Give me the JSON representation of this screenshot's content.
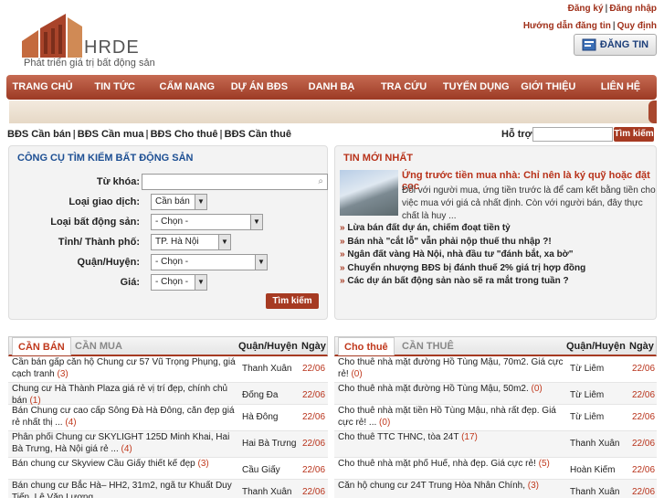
{
  "header": {
    "logo_brand": "HRDE",
    "logo_tagline": "Phát triển giá trị bất động sản",
    "register": "Đăng ký",
    "login": "Đăng nhập",
    "guide": "Hướng dẫn đăng tin",
    "rules": "Quy định",
    "post_button": "ĐĂNG TIN"
  },
  "nav": [
    "TRANG CHỦ",
    "TIN TỨC",
    "CẨM NANG",
    "DỰ ÁN BĐS",
    "DANH BẠ",
    "TRA CỨU",
    "TUYỂN DỤNG",
    "GIỚI THIỆU",
    "LIÊN HỆ"
  ],
  "categories": [
    "BĐS Cần bán",
    "BĐS Cần mua",
    "BĐS Cho thuê",
    "BĐS Cần thuê"
  ],
  "support": {
    "label": "Hỗ trợ",
    "search_button": "Tìm kiếm"
  },
  "search_tool": {
    "title": "CÔNG CỤ TÌM KIẾM BẤT ĐỘNG SẢN",
    "fields": [
      {
        "label": "Từ khóa:",
        "value": ""
      },
      {
        "label": "Loại giao dịch:",
        "value": "Cần bán"
      },
      {
        "label": "Loại bất động sản:",
        "value": "- Chọn -"
      },
      {
        "label": "Tỉnh/ Thành phố:",
        "value": "TP. Hà Nội"
      },
      {
        "label": "Quận/Huyện:",
        "value": "- Chọn -"
      },
      {
        "label": "Giá:",
        "value": "- Chọn -"
      }
    ],
    "button": "Tìm kiếm"
  },
  "news": {
    "title": "TIN MỚI NHẤT",
    "headline": "Ứng trước tiền mua nhà: Chỉ nên là ký quỹ hoặc đặt cọc",
    "lead": "Đối với người mua, ứng tiền trước là để cam kết bằng tiền cho việc mua với giá cả nhất định. Còn với người bán, đây thực chất là huy ...",
    "items": [
      "Lừa bán đất dự án, chiếm đoạt tiền tỷ",
      "Bán nhà \"cắt lỗ\" vẫn phải nộp thuế thu nhập ?!",
      "Ngân đất vàng Hà Nội, nhà đầu tư \"đánh bắt, xa bờ\"",
      "Chuyển nhượng BĐS bị đánh thuế 2% giá trị hợp đồng",
      "Các dự án bất động sản nào sẽ ra mắt trong tuần ?"
    ]
  },
  "sale_list": {
    "tab_active": "CẦN BÁN",
    "tab_other": "CẦN MUA",
    "col_district": "Quận/Huyện",
    "col_date": "Ngày",
    "rows": [
      {
        "title": "Cần bán gấp căn hộ Chung cư 57 Vũ Trọng Phụng, giá cạch tranh",
        "count": "(3)",
        "district": "Thanh Xuân",
        "date": "22/06"
      },
      {
        "title": "Chung cư Hà Thành Plaza giá rẻ vị trí đẹp, chính chủ bán",
        "count": "(1)",
        "district": "Đống Đa",
        "date": "22/06"
      },
      {
        "title": "Bán Chung cư cao cấp Sông Đà Hà Đông, căn đẹp giá rẻ nhất thị ...",
        "count": "(4)",
        "district": "Hà Đông",
        "date": "22/06"
      },
      {
        "title": "Phân phối Chung cư SKYLIGHT 125D Minh Khai, Hai Bà Trưng, Hà Nội giá rẻ ...",
        "count": "(4)",
        "district": "Hai Bà Trưng",
        "date": "22/06"
      },
      {
        "title": "Bán chung cư Skyview Cầu Giấy thiết kế đẹp",
        "count": "(3)",
        "district": "Cầu Giấy",
        "date": "22/06"
      },
      {
        "title": "Bán chung cư Bắc Hà– HH2, 31m2, ngã tư Khuất Duy Tiến, Lê Văn Lương",
        "count": "",
        "district": "Thanh Xuân",
        "date": "22/06"
      }
    ]
  },
  "rent_list": {
    "tab_active": "Cho thuê",
    "tab_other": "CẦN THUÊ",
    "col_district": "Quận/Huyện",
    "col_date": "Ngày",
    "rows": [
      {
        "title": "Cho thuê nhà mặt đường Hồ Tùng Mậu, 70m2. Giá cực rẻ!",
        "count": "(0)",
        "district": "Từ Liêm",
        "date": "22/06"
      },
      {
        "title": "Cho thuê nhà mặt đường Hồ Tùng Mậu, 50m2.",
        "count": "(0)",
        "district": "Từ Liêm",
        "date": "22/06"
      },
      {
        "title": "Cho thuê nhà mặt tiền Hồ Tùng Mậu, nhà rất đẹp. Giá cực rẻ! ...",
        "count": "(0)",
        "district": "Từ Liêm",
        "date": "22/06"
      },
      {
        "title": "Cho thuê TTC THNC, tòa 24T",
        "count": "(17)",
        "district": "Thanh Xuân",
        "date": "22/06"
      },
      {
        "title": "Cho thuê nhà mặt phố Huế, nhà đẹp. Giá cực rẻ!",
        "count": "(5)",
        "district": "Hoàn Kiếm",
        "date": "22/06"
      },
      {
        "title": "Căn hộ chung cư 24T Trung Hòa Nhân Chính,",
        "count": "(3)",
        "district": "Thanh Xuân",
        "date": "22/06"
      }
    ]
  }
}
